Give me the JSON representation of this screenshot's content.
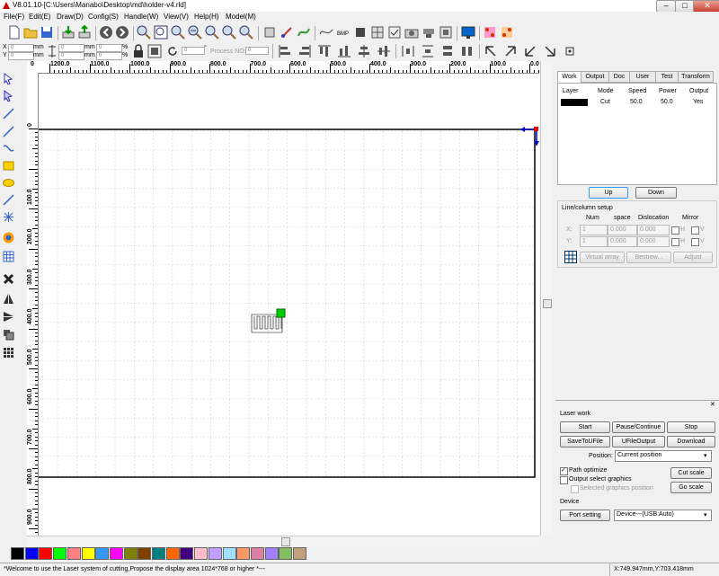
{
  "window": {
    "title": "V8.01.10-[C:\\Users\\Manabo\\Desktop\\md\\holder-v4.rld]",
    "min": "–",
    "max": "□",
    "close": "✕"
  },
  "menu": [
    "File(F)",
    "Edit(E)",
    "Draw(D)",
    "Config(S)",
    "Handle(W)",
    "View(V)",
    "Help(H)",
    "Model(M)"
  ],
  "coords": {
    "x_label": "X",
    "y_label": "Y",
    "x_value": "0",
    "y_value": "0",
    "unit_mm": "mm",
    "w_value": "0",
    "h_value": "0",
    "pct": "%",
    "pct_x": "0",
    "pct_y": "0",
    "rotate_value": "0",
    "deg": "°",
    "process_no_label": "Process NO:",
    "process_no_value": "0"
  },
  "ruler_top": [
    "1200.0",
    "1100.0",
    "1000.0",
    "900.0",
    "800.0",
    "700.0",
    "600.0",
    "500.0",
    "400.0",
    "300.0",
    "200.0",
    "100.0",
    "0.0"
  ],
  "ruler_top_edge": "0",
  "ruler_left": [
    "0",
    "100.0",
    "200.0",
    "300.0",
    "400.0",
    "500.0",
    "600.0",
    "700.0",
    "800.0",
    "900.0",
    "1000.0"
  ],
  "panel": {
    "tabs": [
      "Work",
      "Output",
      "Doc",
      "User",
      "Test",
      "Transform"
    ],
    "table_headers": [
      "Layer",
      "Mode",
      "Speed",
      "Power",
      "Output"
    ],
    "rows": [
      {
        "color": "#000000",
        "mode": "Cut",
        "speed": "50.0",
        "power": "50.0",
        "output": "Yes"
      }
    ],
    "up": "Up",
    "down": "Down",
    "linecol": {
      "title": "Line/column setup",
      "h_num": "Num",
      "h_space": "space",
      "h_dislocation": "Dislocation",
      "h_mirror": "Mirror",
      "x_label": "X:",
      "y_label": "Y:",
      "x_num": "1",
      "x_space": "0.000",
      "x_disl": "0.000",
      "y_num": "1",
      "y_space": "0.000",
      "y_disl": "0.000",
      "h": "H",
      "v": "V",
      "virtual_array": "Virtual array",
      "bestrew": "Bestrew...",
      "adjust": "Adjust"
    },
    "laser": {
      "title": "Laser work",
      "start": "Start",
      "pause": "Pause/Continue",
      "stop": "Stop",
      "save_to_ufile": "SaveToUFile",
      "ufile_output": "UFileOutput",
      "download": "Download",
      "position_label": "Position:",
      "position_value": "Current position",
      "path_optimize": "Path optimize",
      "output_select": "Output select graphics",
      "selected_pos": "Selected graphics position",
      "cut_scale": "Cut scale",
      "go_scale": "Go scale"
    },
    "device": {
      "title": "Device",
      "port_setting": "Port setting",
      "device_value": "Device---(USB:Auto)"
    }
  },
  "palette": [
    "#000000",
    "#0000ff",
    "#ff0000",
    "#00ff00",
    "#ff8080",
    "#ffff00",
    "#3399ff",
    "#ff00ff",
    "#808000",
    "#804000",
    "#008080",
    "#ff6600",
    "#400080",
    "#ffc0cb",
    "#c0a0ff",
    "#a0e0ff",
    "#ff9966",
    "#e080a0",
    "#a080ff",
    "#80c060",
    "#c0a080"
  ],
  "status": {
    "message": "*Welcome to use the Laser system of cutting,Propose the display area 1024*768 or higher *---",
    "position": "X:749.947mm,Y:703.418mm"
  }
}
